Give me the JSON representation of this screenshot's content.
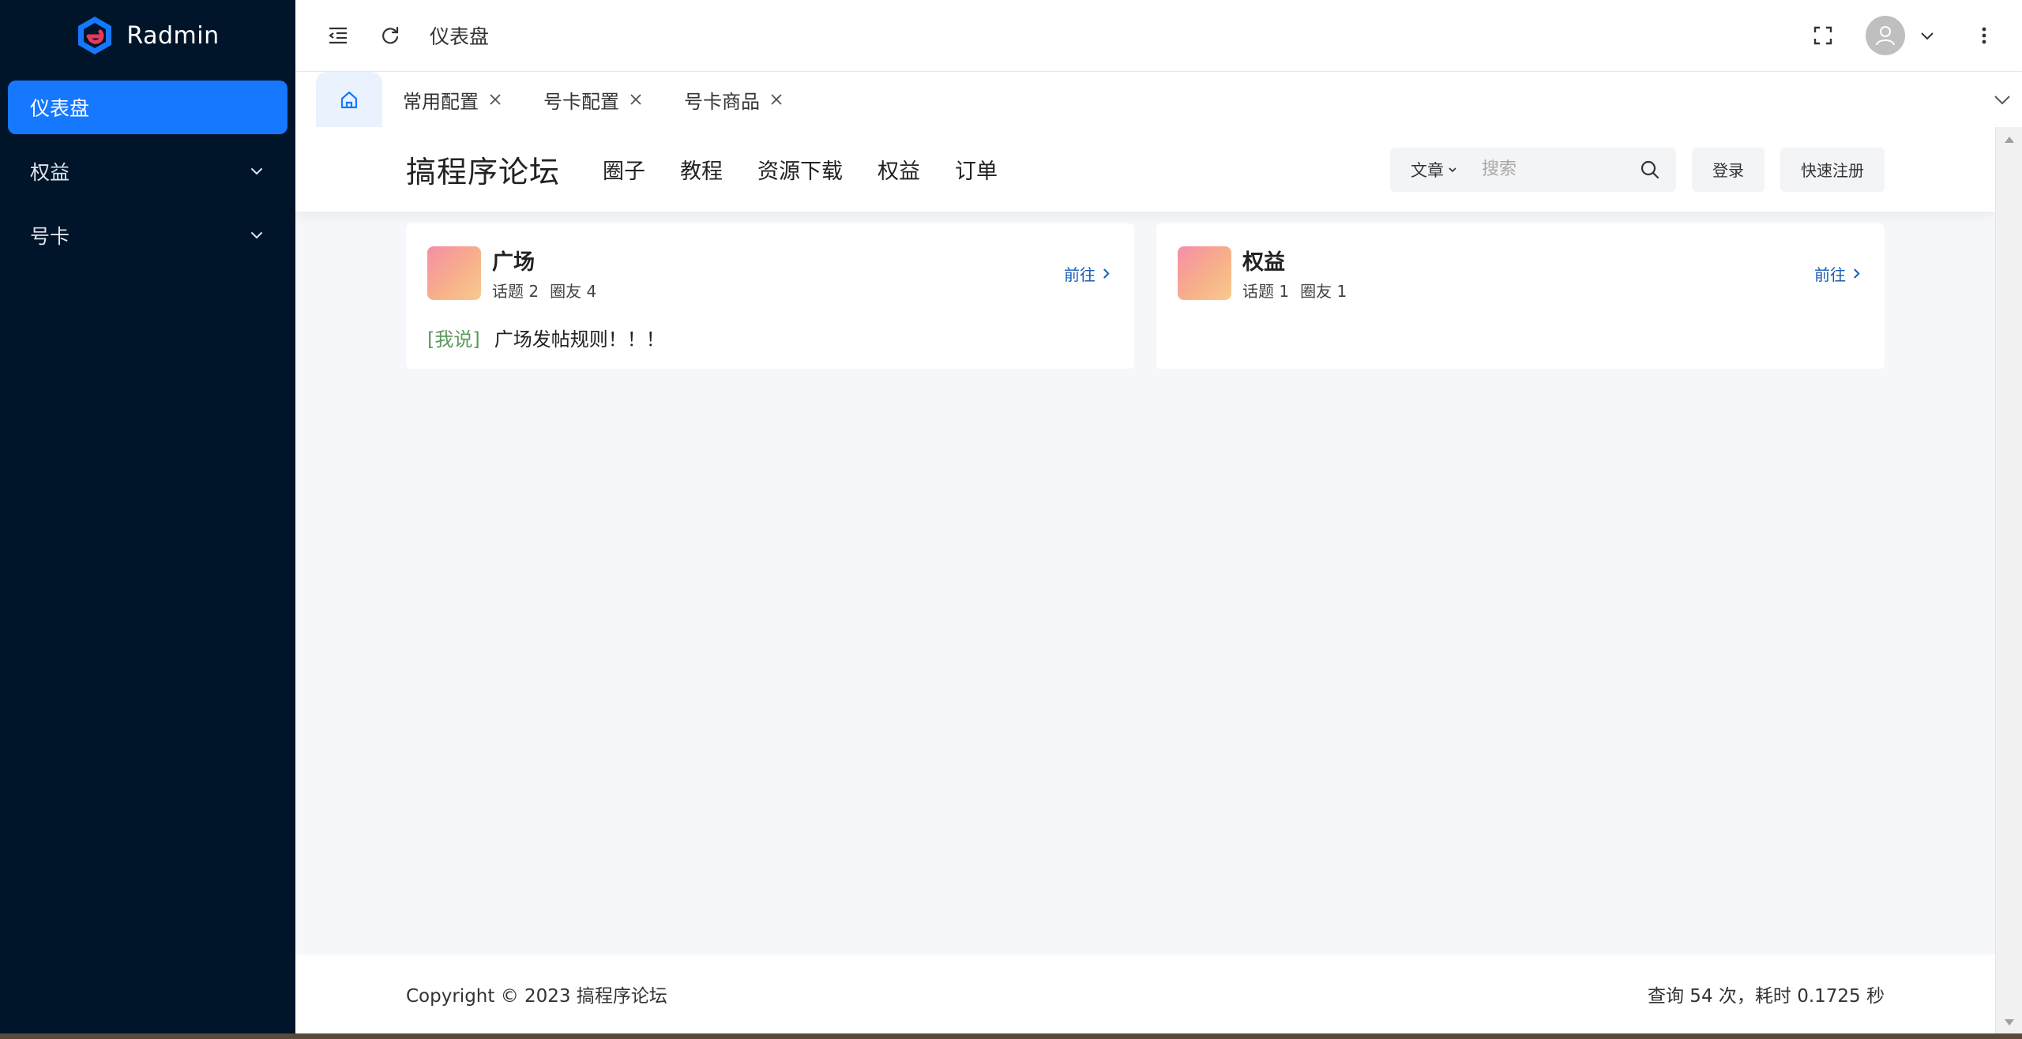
{
  "app": {
    "name": "Radmin"
  },
  "sidebar": {
    "items": [
      {
        "label": "仪表盘",
        "active": true
      },
      {
        "label": "权益",
        "expandable": true
      },
      {
        "label": "号卡",
        "expandable": true
      }
    ]
  },
  "header": {
    "title": "仪表盘"
  },
  "tabs": [
    {
      "label": "常用配置"
    },
    {
      "label": "号卡配置"
    },
    {
      "label": "号卡商品"
    }
  ],
  "forum": {
    "title": "搞程序论坛",
    "nav": [
      "圈子",
      "教程",
      "资源下载",
      "权益",
      "订单"
    ],
    "search": {
      "type": "文章",
      "placeholder": "搜索"
    },
    "login_label": "登录",
    "register_label": "快速注册"
  },
  "cards": [
    {
      "title": "广场",
      "topics": "话题 2",
      "members": "圈友 4",
      "go_label": "前往",
      "post": {
        "tag": "[我说]",
        "text": "广场发帖规则！！！"
      }
    },
    {
      "title": "权益",
      "topics": "话题 1",
      "members": "圈友 1",
      "go_label": "前往"
    }
  ],
  "footer": {
    "copyright": "Copyright © 2023 搞程序论坛",
    "stats": "查询 54 次，耗时 0.1725 秒"
  },
  "colors": {
    "sidebar_bg": "#001529",
    "accent": "#1677ff",
    "link": "#1a5db8",
    "tag": "#5b9a5b"
  }
}
